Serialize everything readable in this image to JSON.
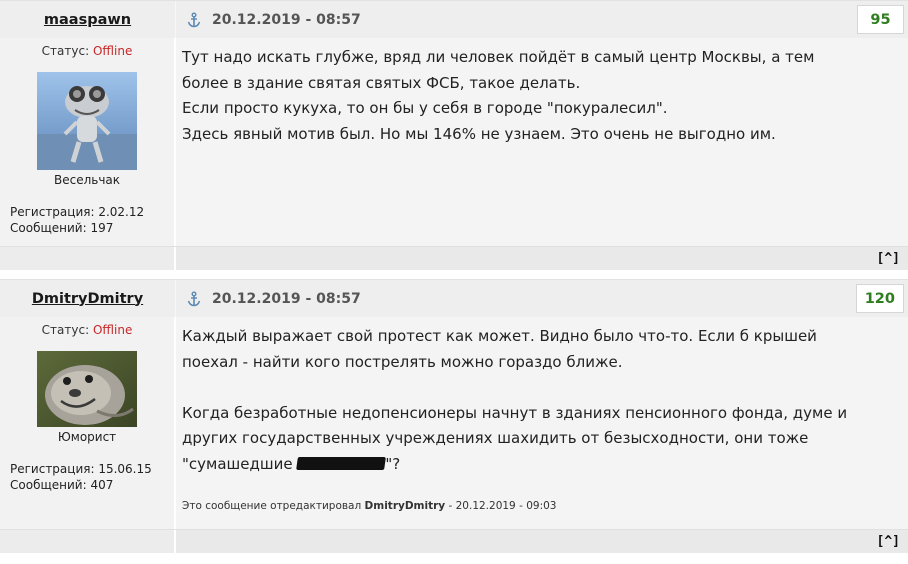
{
  "posts": [
    {
      "author": "maaspawn",
      "status_label": "Статус:",
      "status_value": "Offline",
      "rank": "Весельчак",
      "reg": "Регистрация: 2.02.12",
      "msgs": "Сообщений: 197",
      "date": "20.12.2019 - 08:57",
      "number": "95",
      "lines": [
        "Тут надо искать глубже, вряд ли человек пойдёт в самый центр Москвы, а тем",
        "более в здание святая святых ФСБ, такое делать.",
        "Если просто кукуха, то он бы у себя в городе \"покуралесил\".",
        "Здесь явный мотив был. Но мы 146% не узнаем. Это очень не выгодно им."
      ],
      "top_link": "[^]"
    },
    {
      "author": "DmitryDmitry",
      "status_label": "Статус:",
      "status_value": "Offline",
      "rank": "Юморист",
      "reg": "Регистрация: 15.06.15",
      "msgs": "Сообщений: 407",
      "date": "20.12.2019 - 08:57",
      "number": "120",
      "lines": [
        "Каждый выражает свой протест как может. Видно было что-то. Если б крышей",
        "поехал - найти кого пострелять можно гораздо ближе.",
        "",
        "Когда безработные недопенсионеры начнут в зданиях пенсионного фонда, думе и",
        "других государственных учреждениях шахидить от безысходности, они тоже"
      ],
      "last_line_before": "\"сумашедшие ",
      "last_line_after": "\"?",
      "edit_prefix": "Это сообщение отредактировал ",
      "edit_author": "DmitryDmitry",
      "edit_date": " - 20.12.2019 - 09:03",
      "top_link": "[^]"
    }
  ],
  "colors": {
    "post_number": "#2e7d1f",
    "offline": "#c62828",
    "header_bg": "#eeeeee",
    "body_bg": "#f4f4f4"
  },
  "icons": {
    "post_link": "anchor-icon",
    "avatar_1": "crazy-frog-avatar",
    "avatar_2": "smiling-seal-avatar"
  }
}
